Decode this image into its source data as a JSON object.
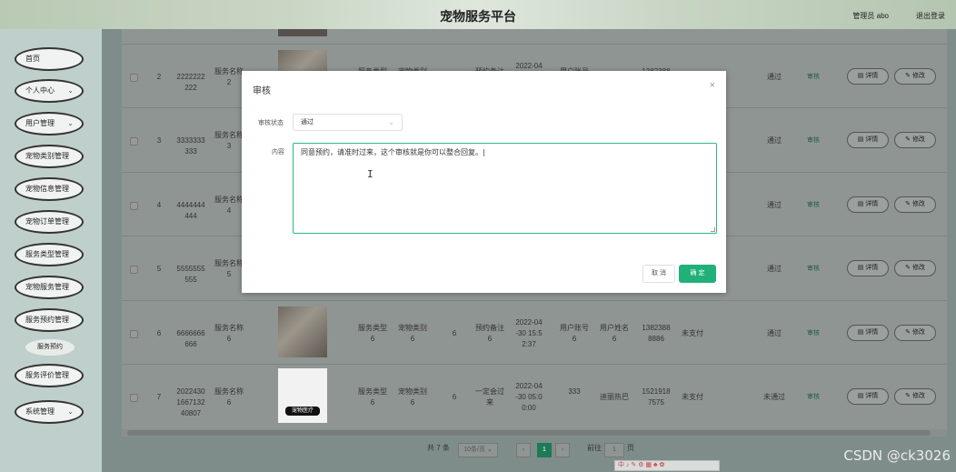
{
  "header": {
    "title": "宠物服务平台",
    "admin": "管理员 abo",
    "logout": "退出登录"
  },
  "sidebar": {
    "items": [
      {
        "label": "首页",
        "chevron": false
      },
      {
        "label": "个人中心",
        "chevron": true
      },
      {
        "label": "用户管理",
        "chevron": true
      },
      {
        "label": "宠物类别管理",
        "chevron": false
      },
      {
        "label": "宠物信息管理",
        "chevron": false
      },
      {
        "label": "宠物订单管理",
        "chevron": false
      },
      {
        "label": "服务类型管理",
        "chevron": false
      },
      {
        "label": "宠物服务管理",
        "chevron": false
      },
      {
        "label": "服务预约管理",
        "chevron": false
      },
      {
        "label": "服务评价管理",
        "chevron": false
      },
      {
        "label": "系统管理",
        "chevron": true
      }
    ],
    "subitem": "服务预约"
  },
  "table": {
    "rows": [
      {
        "idx": "2",
        "no": "2222222\n222",
        "svc": "服务名称\n2",
        "type": "服务类型",
        "cat": "宠物类别",
        "qty": "",
        "note": "预约备注",
        "time": "2022-04\n-30 15:5\n2:37",
        "acct": "用户账号",
        "name": "用户姓名",
        "phone": "1382388",
        "pay": "",
        "audit": "通过",
        "action": "审核",
        "detail": "详情",
        "edit": "修改"
      },
      {
        "idx": "3",
        "no": "3333333\n333",
        "svc": "服务名称\n3",
        "type": "",
        "cat": "",
        "qty": "",
        "note": "",
        "time": "",
        "acct": "",
        "name": "",
        "phone": "",
        "pay": "",
        "audit": "通过",
        "action": "审核",
        "detail": "详情",
        "edit": "修改"
      },
      {
        "idx": "4",
        "no": "4444444\n444",
        "svc": "服务名称\n4",
        "type": "",
        "cat": "",
        "qty": "",
        "note": "",
        "time": "",
        "acct": "",
        "name": "",
        "phone": "",
        "pay": "",
        "audit": "通过",
        "action": "审核",
        "detail": "详情",
        "edit": "修改"
      },
      {
        "idx": "5",
        "no": "5555555\n555",
        "svc": "服务名称\n5",
        "type": "",
        "cat": "",
        "qty": "",
        "note": "",
        "time": "",
        "acct": "",
        "name": "",
        "phone": "",
        "pay": "",
        "audit": "通过",
        "action": "审核",
        "detail": "详情",
        "edit": "修改"
      },
      {
        "idx": "6",
        "no": "6666666\n666",
        "svc": "服务名称\n6",
        "type": "服务类型\n6",
        "cat": "宠物类别\n6",
        "qty": "6",
        "note": "预约备注\n6",
        "time": "2022-04\n-30 15:5\n2:37",
        "acct": "用户账号\n6",
        "name": "用户姓名\n6",
        "phone": "1382388\n8886",
        "pay": "未支付",
        "audit": "通过",
        "action": "审核",
        "detail": "详情",
        "edit": "修改"
      },
      {
        "idx": "7",
        "no": "2022430\n1667132\n40807",
        "svc": "服务名称\n6",
        "type": "服务类型\n6",
        "cat": "宠物类别\n6",
        "qty": "6",
        "note": "一定会过\n来",
        "time": "2022-04\n-30 05:0\n0:00",
        "acct": "333",
        "name": "迪丽热巴",
        "phone": "1521918\n7575",
        "pay": "未支付",
        "audit": "未通过",
        "action": "审核",
        "detail": "详情",
        "edit": "修改"
      }
    ],
    "logo_text": "宠物医疗"
  },
  "pagination": {
    "total": "共 7 条",
    "page_size": "10条/页",
    "current": "1",
    "goto_label": "前往",
    "goto_value": "1",
    "page_suffix": "页"
  },
  "modal": {
    "title": "审核",
    "close": "×",
    "status_label": "审核状态",
    "status_value": "通过",
    "content_label": "内容",
    "content_value": "同意预约，请准时过来，这个审核就是你可以整合回复。|",
    "cancel": "取 消",
    "confirm": "确 定"
  },
  "watermark": "CSDN @ck3026",
  "tray": "中 ♪ ✎ ⚙ ▦ ♣ ✿"
}
